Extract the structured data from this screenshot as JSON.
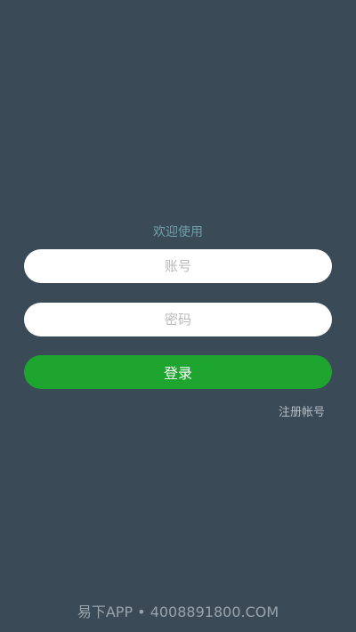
{
  "welcome_text": "欢迎使用",
  "form": {
    "username_placeholder": "账号",
    "username_value": "",
    "password_placeholder": "密码",
    "password_value": "",
    "login_label": "登录",
    "register_label": "注册帐号"
  },
  "watermark": "易下APP • 4008891800.COM",
  "colors": {
    "background": "#3a4a57",
    "welcome": "#6fa0a8",
    "login_button": "#1ea52f",
    "input_background": "#ffffff",
    "register_link": "#b7bec4"
  }
}
